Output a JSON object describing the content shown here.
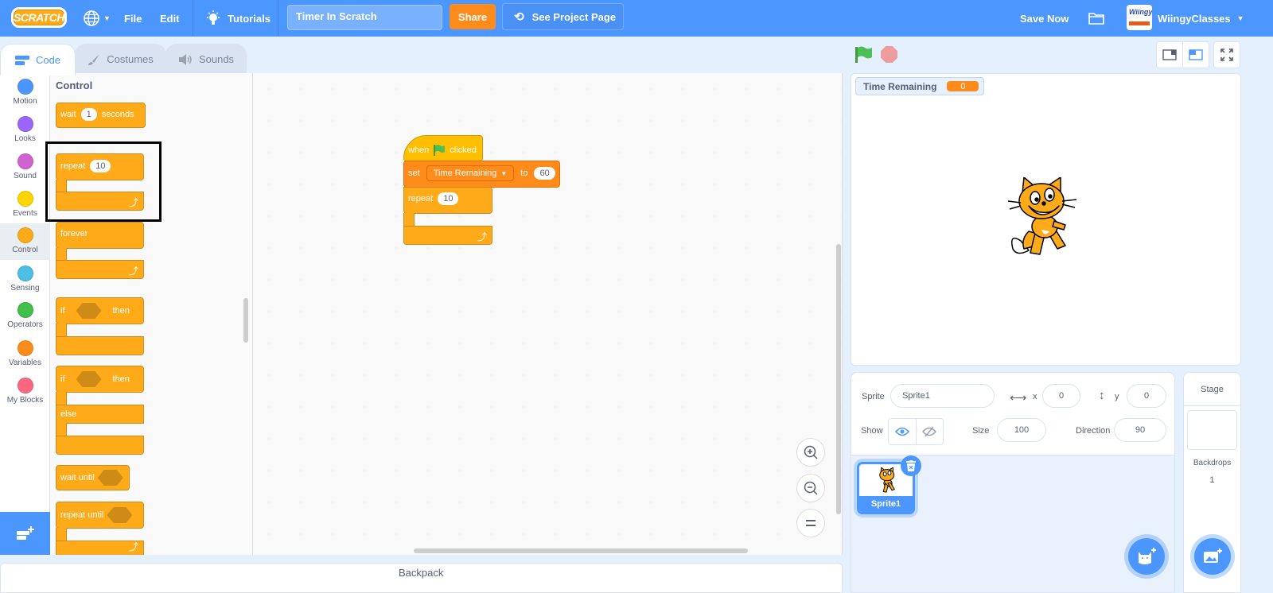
{
  "menubar": {
    "logo": "SCRATCH",
    "language_icon": "globe-icon",
    "file": "File",
    "edit": "Edit",
    "tutorials": "Tutorials",
    "project_title": "Timer In Scratch",
    "share": "Share",
    "see_project_page": "See Project Page",
    "save_now": "Save Now",
    "my_stuff_icon": "folder-icon",
    "avatar_text": "Wiingy",
    "username": "WiingyClasses"
  },
  "tabs": [
    {
      "label": "Code",
      "icon": "code-icon",
      "active": true
    },
    {
      "label": "Costumes",
      "icon": "brush-icon",
      "active": false
    },
    {
      "label": "Sounds",
      "icon": "speaker-icon",
      "active": false
    }
  ],
  "categories": [
    {
      "label": "Motion",
      "color": "#4c97ff"
    },
    {
      "label": "Looks",
      "color": "#9966ff"
    },
    {
      "label": "Sound",
      "color": "#cf63cf"
    },
    {
      "label": "Events",
      "color": "#ffd500"
    },
    {
      "label": "Control",
      "color": "#ffab19",
      "active": true
    },
    {
      "label": "Sensing",
      "color": "#4cbfe6"
    },
    {
      "label": "Operators",
      "color": "#40bf4a"
    },
    {
      "label": "Variables",
      "color": "#ff8c1a"
    },
    {
      "label": "My Blocks",
      "color": "#ff6680"
    }
  ],
  "flyout": {
    "title": "Control",
    "blocks": {
      "wait": {
        "pre": "wait",
        "value": "1",
        "post": "seconds"
      },
      "repeat": {
        "pre": "repeat",
        "value": "10"
      },
      "forever": {
        "label": "forever"
      },
      "if_then": {
        "pre": "if",
        "post": "then"
      },
      "if_else": {
        "pre": "if",
        "post": "then",
        "else": "else"
      },
      "wait_until": {
        "label": "wait until"
      },
      "repeat_until": {
        "label": "repeat until"
      }
    }
  },
  "script": {
    "hat": {
      "pre": "when",
      "post": "clicked"
    },
    "set": {
      "pre": "set",
      "variable": "Time Remaining",
      "mid": "to",
      "value": "60"
    },
    "repeat": {
      "pre": "repeat",
      "value": "10"
    }
  },
  "workspace_controls": [
    "zoom-in",
    "zoom-out",
    "reset-zoom"
  ],
  "stage": {
    "monitor_label": "Time Remaining",
    "monitor_value": "0"
  },
  "sprite_info": {
    "sprite_label": "Sprite",
    "sprite_name": "Sprite1",
    "x_label": "x",
    "x_value": "0",
    "y_label": "y",
    "y_value": "0",
    "show_label": "Show",
    "size_label": "Size",
    "size_value": "100",
    "direction_label": "Direction",
    "direction_value": "90"
  },
  "sprites": [
    {
      "name": "Sprite1",
      "selected": true
    }
  ],
  "stage_selector": {
    "title": "Stage",
    "backdrops_label": "Backdrops",
    "backdrops_count": "1"
  },
  "backpack": {
    "label": "Backpack"
  }
}
